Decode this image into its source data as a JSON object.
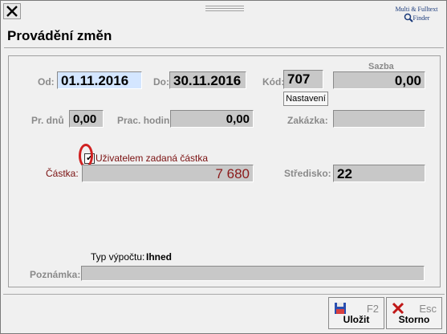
{
  "window": {
    "title": "Provádění změn",
    "finder_line1": "Multi & Fulltext",
    "finder_line2": "Finder"
  },
  "form": {
    "od_label": "Od:",
    "od_value": "01.11.2016",
    "do_label": "Do:",
    "do_value": "30.11.2016",
    "kod_label": "Kód:",
    "kod_value": "707",
    "sazba_label": "Sazba",
    "sazba_value": "0,00",
    "nastaveni_label": "Nastavení",
    "pr_dnu_label": "Pr. dnů",
    "pr_dnu_value": "0,00",
    "prac_hodin_label": "Prac. hodin",
    "prac_hodin_value": "0,00",
    "zakazka_label": "Zakázka:",
    "zakazka_value": "",
    "checkbox_label": "Uživatelem zadaná částka",
    "checkbox_checked": true,
    "checkbox_mark": "✔",
    "castka_label": "Částka:",
    "castka_value": "7 680",
    "stredisko_label": "Středisko:",
    "stredisko_value": "22",
    "typ_vypoctu_label": "Typ výpočtu:",
    "typ_vypoctu_value": "Ihned",
    "poznamka_label": "Poznámka:",
    "poznamka_value": ""
  },
  "footer": {
    "save": {
      "label": "Uložit",
      "key": "F2",
      "icon": "save-icon"
    },
    "cancel": {
      "label": "Storno",
      "key": "Esc",
      "icon": "close-x-icon"
    }
  },
  "colors": {
    "active_field": "#d4e6ff",
    "field": "#c8c8c8",
    "highlight_ring": "#d02020",
    "amount_text": "#8b1a1a"
  }
}
